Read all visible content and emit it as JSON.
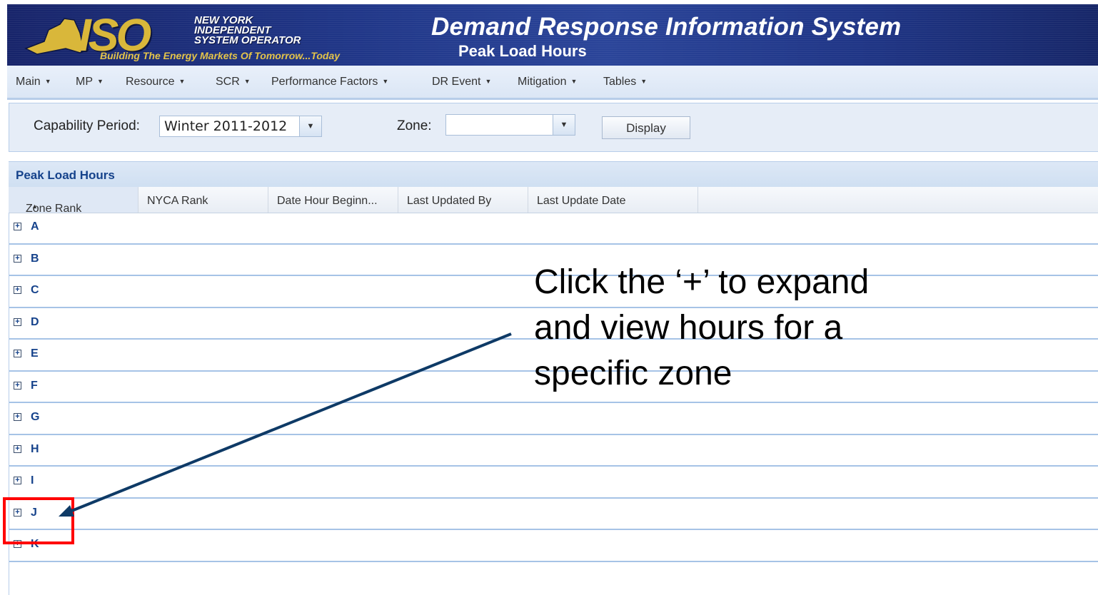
{
  "header": {
    "logo_text": "ISO",
    "org_lines": [
      "NEW YORK",
      "INDEPENDENT",
      "SYSTEM OPERATOR"
    ],
    "tagline": "Building The Energy Markets Of Tomorrow...Today",
    "app_title": "Demand Response Information System",
    "page_subtitle": "Peak Load Hours"
  },
  "menu": {
    "items": [
      {
        "label": "Main"
      },
      {
        "label": "MP"
      },
      {
        "label": "Resource"
      },
      {
        "label": "SCR"
      },
      {
        "label": "Performance Factors"
      },
      {
        "label": "DR Event"
      },
      {
        "label": "Mitigation"
      },
      {
        "label": "Tables"
      }
    ],
    "dropdown_icon": "caret-down-icon"
  },
  "filters": {
    "capability_period_label": "Capability Period:",
    "capability_period_value": "Winter 2011-2012",
    "zone_label": "Zone:",
    "zone_value": "",
    "display_button": "Display"
  },
  "grid": {
    "title": "Peak Load Hours",
    "columns": [
      {
        "label": "Zone Rank",
        "sorted": "asc"
      },
      {
        "label": "NYCA Rank"
      },
      {
        "label": "Date Hour Beginn..."
      },
      {
        "label": "Last Updated By"
      },
      {
        "label": "Last Update Date"
      }
    ],
    "groups": [
      "A",
      "B",
      "C",
      "D",
      "E",
      "F",
      "G",
      "H",
      "I",
      "J",
      "K"
    ],
    "expand_icon": "plus-box-icon"
  },
  "annotation": {
    "lines": [
      "Click the ‘+’ to expand",
      "and view hours for a",
      "specific zone"
    ],
    "highlight_color": "#ff0000",
    "arrow_color": "#0e3a66",
    "target_group": "J"
  },
  "colors": {
    "banner_blue": "#1f3586",
    "logo_gold": "#d9b73a",
    "group_text": "#15428b",
    "row_divider": "#a6c3e6"
  }
}
